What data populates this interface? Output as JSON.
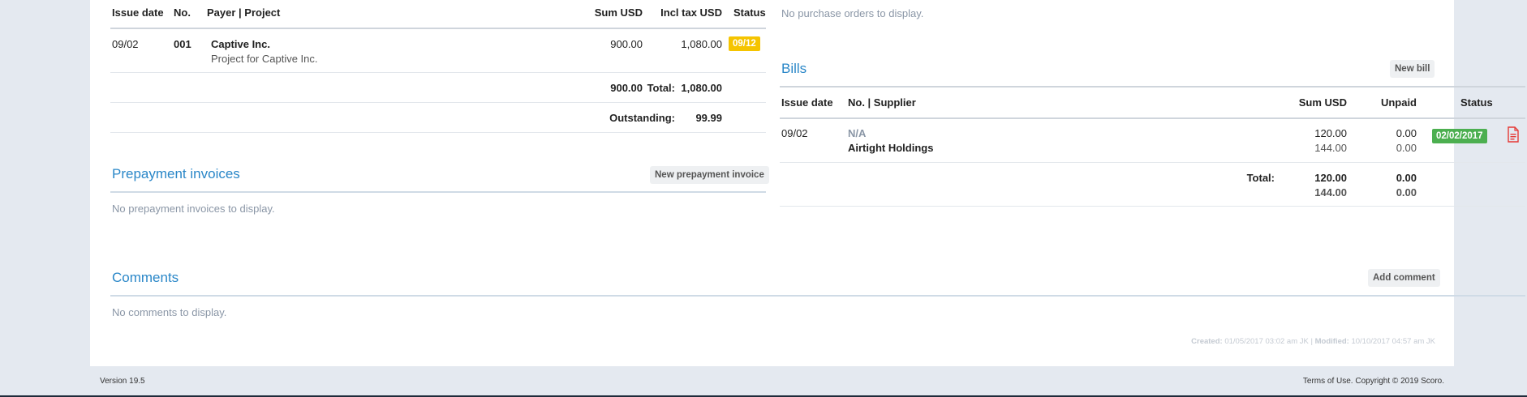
{
  "colors": {
    "accent": "#2a87c8",
    "status_overdue": "#f5c400",
    "status_paid": "#4caf50",
    "page_bg": "#e4e9f0",
    "pdf_icon": "#e53935"
  },
  "invoices": {
    "columns": [
      "Issue date",
      "No.",
      "Payer | Project",
      "Sum USD",
      "Incl tax USD",
      "Status"
    ],
    "rows": [
      {
        "issue_date": "09/02",
        "no": "001",
        "payer": "Captive Inc.",
        "project": "Project for Captive Inc.",
        "sum": "900.00",
        "incl_tax": "1,080.00",
        "status": "09/12"
      }
    ],
    "total_label": "Total:",
    "total_sum": "900.00",
    "total_incl_tax": "1,080.00",
    "outstanding_label": "Outstanding:",
    "outstanding_value": "99.99"
  },
  "purchase_orders": {
    "empty": "No purchase orders to display."
  },
  "prepayment": {
    "title": "Prepayment invoices",
    "button": "New prepayment invoice",
    "empty": "No prepayment invoices to display."
  },
  "bills": {
    "title": "Bills",
    "button": "New bill",
    "columns": [
      "Issue date",
      "No. | Supplier",
      "Sum USD",
      "Unpaid",
      "Status"
    ],
    "rows": [
      {
        "issue_date": "09/02",
        "no": "N/A",
        "supplier": "Airtight Holdings",
        "sum": "120.00",
        "sum_tax": "144.00",
        "unpaid": "0.00",
        "unpaid_tax": "0.00",
        "status": "02/02/2017",
        "icon": "pdf-icon"
      }
    ],
    "total_label": "Total:",
    "total_sum": "120.00",
    "total_sum_tax": "144.00",
    "total_unpaid": "0.00",
    "total_unpaid_tax": "0.00"
  },
  "comments": {
    "title": "Comments",
    "button": "Add comment",
    "empty": "No comments to display."
  },
  "meta": {
    "created_label": "Created:",
    "created_value": "01/05/2017 03:02 am JK",
    "separator": "|",
    "modified_label": "Modified:",
    "modified_value": "10/10/2017 04:57 am JK"
  },
  "footer": {
    "version": "Version 19.5",
    "copyright": "Terms of Use. Copyright © 2019 Scoro."
  }
}
